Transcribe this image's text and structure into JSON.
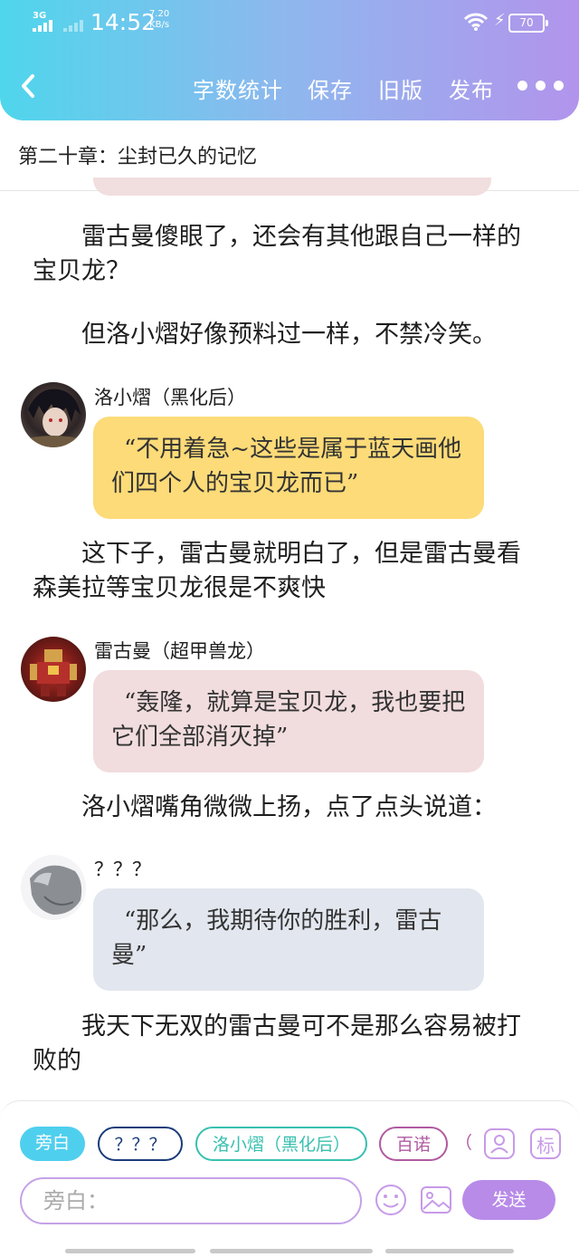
{
  "status_bar": {
    "network": "3G",
    "time": "14:52",
    "speed_value": "7.20",
    "speed_unit": "KB/s",
    "battery": "70"
  },
  "toolbar": {
    "back_icon": "chevron-left-icon",
    "word_count": "字数统计",
    "save": "保存",
    "old_version": "旧版",
    "publish": "发布",
    "more_icon": "more-dots-icon"
  },
  "chapter": {
    "title": "第二十章：尘封已久的记忆"
  },
  "story": {
    "para1": "雷古曼傻眼了，还会有其他跟自己一样的宝贝龙？",
    "para2": "但洛小熠好像预料过一样，不禁冷笑。",
    "msg1": {
      "name": "洛小熠（黑化后）",
      "text": "“不用着急~这些是属于蓝天画他们四个人的宝贝龙而已”",
      "color": "#fcdb78"
    },
    "para3": "这下子，雷古曼就明白了，但是雷古曼看森美拉等宝贝龙很是不爽快",
    "msg2": {
      "name": "雷古曼（超甲兽龙）",
      "text": "“轰隆，就算是宝贝龙，我也要把它们全部消灭掉”",
      "color": "#f1dcde"
    },
    "para4": "洛小熠嘴角微微上扬，点了点头说道：",
    "msg3": {
      "name": "？？？",
      "text": "“那么，我期待你的胜利，雷古曼”",
      "color": "#e2e6ee"
    },
    "para5": "我天下无双的雷古曼可不是那么容易被打败的"
  },
  "composer": {
    "chips": [
      "旁白",
      "？？？",
      "洛小熠（黑化后）",
      "百诺",
      "（"
    ],
    "avatar_tool_icon": "person-icon",
    "tag_tool": "标",
    "input_label": "旁白：",
    "emoji_icon": "smiley-icon",
    "image_icon": "image-icon",
    "send": "发送"
  },
  "colors": {
    "header_start": "#4fd6ec",
    "header_end": "#b294ec",
    "accent": "#b88be8",
    "chip_active": "#4fcfee",
    "chip_teal": "#38c0b0",
    "chip_navy": "#1a3c7a"
  }
}
